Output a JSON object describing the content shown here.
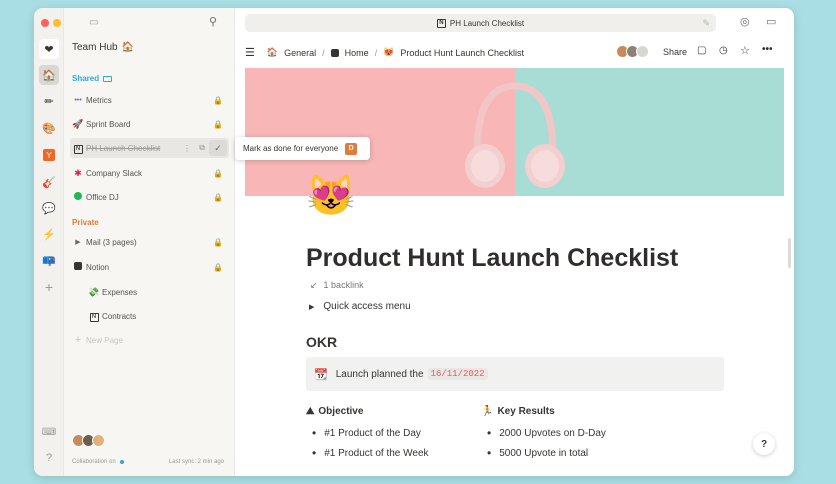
{
  "sidebar": {
    "workspace": "Team Hub",
    "shared_label": "Shared",
    "shared_items": [
      {
        "label": "Metrics",
        "icon": "bars-icon"
      },
      {
        "label": "Sprint Board",
        "icon": "rocket-icon"
      },
      {
        "label": "PH Launch Checklist",
        "icon": "notion-icon"
      },
      {
        "label": "Company Slack",
        "icon": "slack-icon"
      },
      {
        "label": "Office DJ",
        "icon": "spotify-icon"
      }
    ],
    "private_label": "Private",
    "private_items": [
      {
        "label": "Mail (3 pages)"
      },
      {
        "label": "Notion"
      },
      {
        "label": "Expenses"
      },
      {
        "label": "Contracts"
      }
    ],
    "new_page": "New Page",
    "collab": "Collaboration on",
    "sync": "Last sync: 2 min ago"
  },
  "tooltip": {
    "text": "Mark as done for everyone",
    "badge": "D"
  },
  "topbar": {
    "url": "PH Launch Checklist"
  },
  "breadcrumbs": [
    "General",
    "Home",
    "Product Hunt Launch Checklist"
  ],
  "share": "Share",
  "page": {
    "title": "Product Hunt Launch Checklist",
    "backlink": "1 backlink",
    "toggle": "Quick access menu",
    "okr": "OKR",
    "callout_text": "Launch planned the",
    "callout_date": "16/11/2022",
    "objective_head": "Objective",
    "objectives": [
      "#1 Product of the Day",
      "#1 Product of the Week"
    ],
    "kr_head": "Key Results",
    "key_results": [
      "2000 Upvotes on D-Day",
      "5000 Upvote in total"
    ]
  },
  "help": "?",
  "colors": {
    "accent": "#2eaadc",
    "private": "#e07b39",
    "cover_left": "#f8b6b6",
    "cover_right": "#a8ddd6"
  }
}
